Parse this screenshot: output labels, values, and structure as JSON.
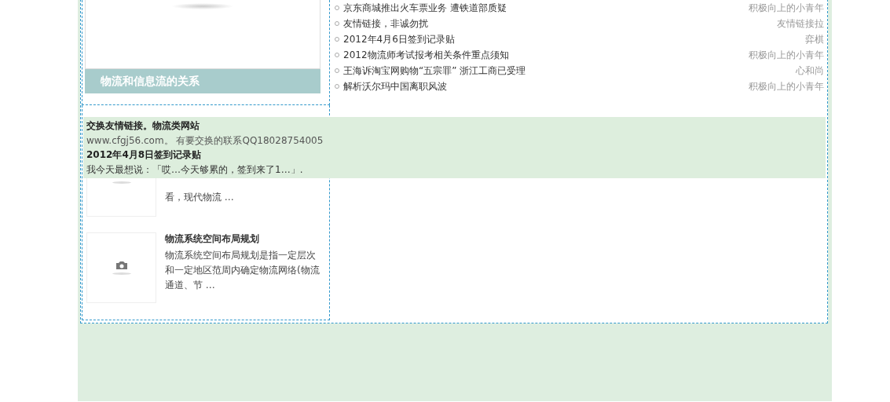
{
  "featured": {
    "caption": "物流和信息流的关系"
  },
  "articles": [
    {
      "partly_hidden": true,
      "desc": "看，现代物流 …"
    },
    {
      "partly_hidden": false,
      "title": "物流系统空间布局规划",
      "desc": "物流系统空间布局规划是指一定层次和一定地区范周内确定物流网络(物流通道、节 …"
    }
  ],
  "posts": [
    {
      "title": "京东商城推出火车票业务 遭铁道部质疑",
      "author": "积极向上的小青年"
    },
    {
      "title": "友情链接，非诚勿扰",
      "author": "友情链接拉"
    },
    {
      "title": "2012年4月6日签到记录贴",
      "author": "弈棋"
    },
    {
      "title": "2012物流师考试报考相关条件重点须知",
      "author": "积极向上的小青年"
    },
    {
      "title": "王海诉淘宝网购物“五宗罪” 浙江工商已受理",
      "author": "心和尚"
    },
    {
      "title": "解析沃尔玛中国离职风波",
      "author": "积极向上的小青年"
    }
  ],
  "popup": {
    "title_1": "交换友情链接。物流类网站",
    "text_1": "www.cfgj56.com。 有要交换的联系QQ18028754005",
    "title_2": "2012年4月8日签到记录贴",
    "text_2": "我今天最想说：「哎…今天够累的，签到来了1…」."
  }
}
